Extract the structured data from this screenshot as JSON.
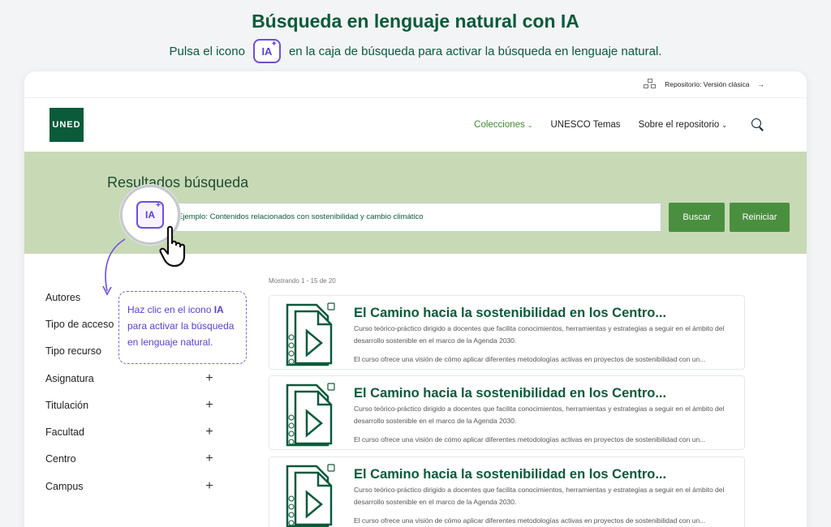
{
  "intro": {
    "title": "Búsqueda en lenguaje natural con IA",
    "sub_before": "Pulsa el icono",
    "ia_label": "IA",
    "sub_after": "en la caja de búsqueda para activar la búsqueda en lenguaje natural."
  },
  "topbar": {
    "repo_link": "Repositorio: Versión clásica",
    "arrow": "→"
  },
  "header": {
    "logo": "UNED",
    "nav": [
      {
        "label": "Colecciones",
        "chevron": "⌄"
      },
      {
        "label": "UNESCO Temas"
      },
      {
        "label": "Sobre el repositorio",
        "chevron": "⌄"
      }
    ]
  },
  "hero": {
    "title": "Resultados búsqueda",
    "search_placeholder": "Ejemplo: Contenidos relacionados con sostenibilidad y cambio climático",
    "search_button": "Buscar",
    "reset_button": "Reiniciar"
  },
  "magnifier": {
    "ia_label": "IA",
    "spark": "+"
  },
  "callout": {
    "line1_before": "Haz clic en el icono ",
    "line1_bold": "IA",
    "line2": "para activar la búsqueda",
    "line3": "en lenguaje natural."
  },
  "sidebar": {
    "items": [
      {
        "label": "Autores",
        "plus": ""
      },
      {
        "label": "Tipo de acceso",
        "plus": ""
      },
      {
        "label": "Tipo recurso",
        "plus": ""
      },
      {
        "label": "Asignatura",
        "plus": "+"
      },
      {
        "label": "Titulación",
        "plus": "+"
      },
      {
        "label": "Facultad",
        "plus": "+"
      },
      {
        "label": "Centro",
        "plus": "+"
      },
      {
        "label": "Campus",
        "plus": "+"
      }
    ]
  },
  "results": {
    "showing": "Mostrando 1 - 15 de 20",
    "items": [
      {
        "title": "El Camino hacia la sostenibilidad en los Centro...",
        "desc": "Curso teórico-práctico dirigido a docentes que facilita conocimientos, herramientas y estrategias a seguir en el ámbito del desarrollo sostenible en el marco de la Agenda 2030.",
        "desc2": "El curso ofrece una visión de cómo aplicar diferentes metodologías activas en proyectos de sostenibilidad con un..."
      },
      {
        "title": "El Camino hacia la sostenibilidad en los Centro...",
        "desc": "Curso teórico-práctico dirigido a docentes que facilita conocimientos, herramientas y estrategias a seguir en el ámbito del desarrollo sostenible en el marco de la Agenda 2030.",
        "desc2": "El curso ofrece una visión de cómo aplicar diferentes metodologías activas en proyectos de sostenibilidad con un..."
      },
      {
        "title": "El Camino hacia la sostenibilidad en los Centro...",
        "desc": "Curso teórico-práctico dirigido a docentes que facilita conocimientos, herramientas y estrategias a seguir en el ámbito del desarrollo sostenible en el marco de la Agenda 2030.",
        "desc2": "El curso ofrece una visión de cómo aplicar diferentes metodologías activas en proyectos de sostenibilidad con un..."
      }
    ]
  }
}
